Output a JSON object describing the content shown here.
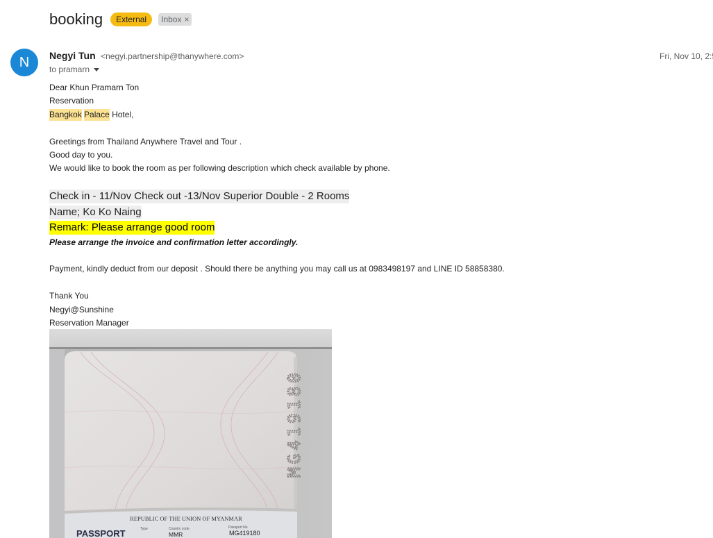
{
  "email": {
    "subject": "booking",
    "labels": {
      "external": {
        "text": "External",
        "color": "#f6bb12"
      },
      "inbox": {
        "text": "Inbox",
        "remove_icon": "close-icon",
        "remove_glyph": "×"
      }
    },
    "sender": {
      "avatar_letter": "N",
      "avatar_color": "#1a88d7",
      "name": "Negyi Tun",
      "address": "<negyi.partnership@thanywhere.com>"
    },
    "date": "Fri, Nov 10, 2:5",
    "recipients": {
      "text": "to pramarn",
      "toggle_icon": "chevron-down-icon"
    },
    "body": {
      "salutation": "Dear Khun Pramarn Ton",
      "department": "Reservation",
      "hotel": {
        "word1": "Bangkok",
        "word2": "Palace",
        "rest": "Hotel,"
      },
      "greeting": "Greetings from Thailand Anywhere Travel and Tour .",
      "good_day": "Good day to you.",
      "request": "We would like to book the room as per following description which check available by phone.",
      "booking_details": "Check in - 11/Nov Check out -13/Nov Superior Double - 2 Rooms",
      "guest_name": "Name; Ko Ko Naing",
      "remark": "Remark: Please arrange good room",
      "invoice_note": "Please arrange the invoice and confirmation letter accordingly.",
      "payment": "Payment, kindly deduct from our deposit . Should there be anything you may call us at 0983498197 and LINE ID 58858380.",
      "closing": "Thank You",
      "signature_name": "Negyi@Sunshine",
      "signature_title": "Reservation Manager",
      "colors": {
        "hotel_highlight": "#fde293",
        "details_background": "#eeeeee",
        "remark_highlight": "#ffff00"
      }
    },
    "attachment_photo": {
      "perforation": "MG419180",
      "issuer": "REPUBLIC OF THE UNION OF MYANMAR",
      "document_type": "PASSPORT",
      "type_label": "Type",
      "country_code_label": "Country code",
      "passport_no_label": "Passport No",
      "country_code": "MMR",
      "passport_no": "MG419180"
    }
  }
}
